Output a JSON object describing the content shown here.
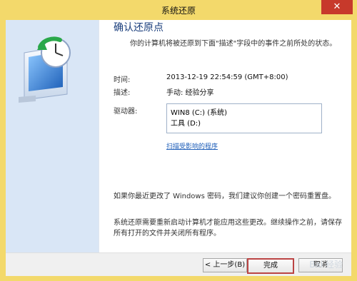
{
  "window": {
    "title": "系统还原",
    "close_glyph": "✕"
  },
  "page": {
    "heading": "确认还原点",
    "subtitle": "你的计算机将被还原到下面\"描述\"字段中的事件之前所处的状态。"
  },
  "details": {
    "time_label": "时间:",
    "time_value": "2013-12-19 22:54:59 (GMT+8:00)",
    "desc_label": "描述:",
    "desc_value": "手动: 经验分享",
    "drives_label": "驱动器:",
    "drives": [
      "WIN8 (C:) (系统)",
      "工具 (D:)"
    ],
    "scan_link": "扫描受影响的程序"
  },
  "notes": {
    "password_note": "如果你最近更改了 Windows 密码，我们建议你创建一个密码重置盘。",
    "restart_note": "系统还原需要重新启动计算机才能应用这些更改。继续操作之前，请保存所有打开的文件并关闭所有程序。"
  },
  "buttons": {
    "back": "< 上一步(B)",
    "finish": "完成",
    "cancel": "取消"
  },
  "watermark": "Bai 经验",
  "icons": {
    "system_restore_icon": "system-restore-icon",
    "close_icon": "close-icon"
  },
  "colors": {
    "frame": "#f3d96b",
    "left_pane": "#d9e6f6",
    "heading": "#1a3e7c",
    "close_button": "#c7392b",
    "link": "#1f5fb9"
  }
}
